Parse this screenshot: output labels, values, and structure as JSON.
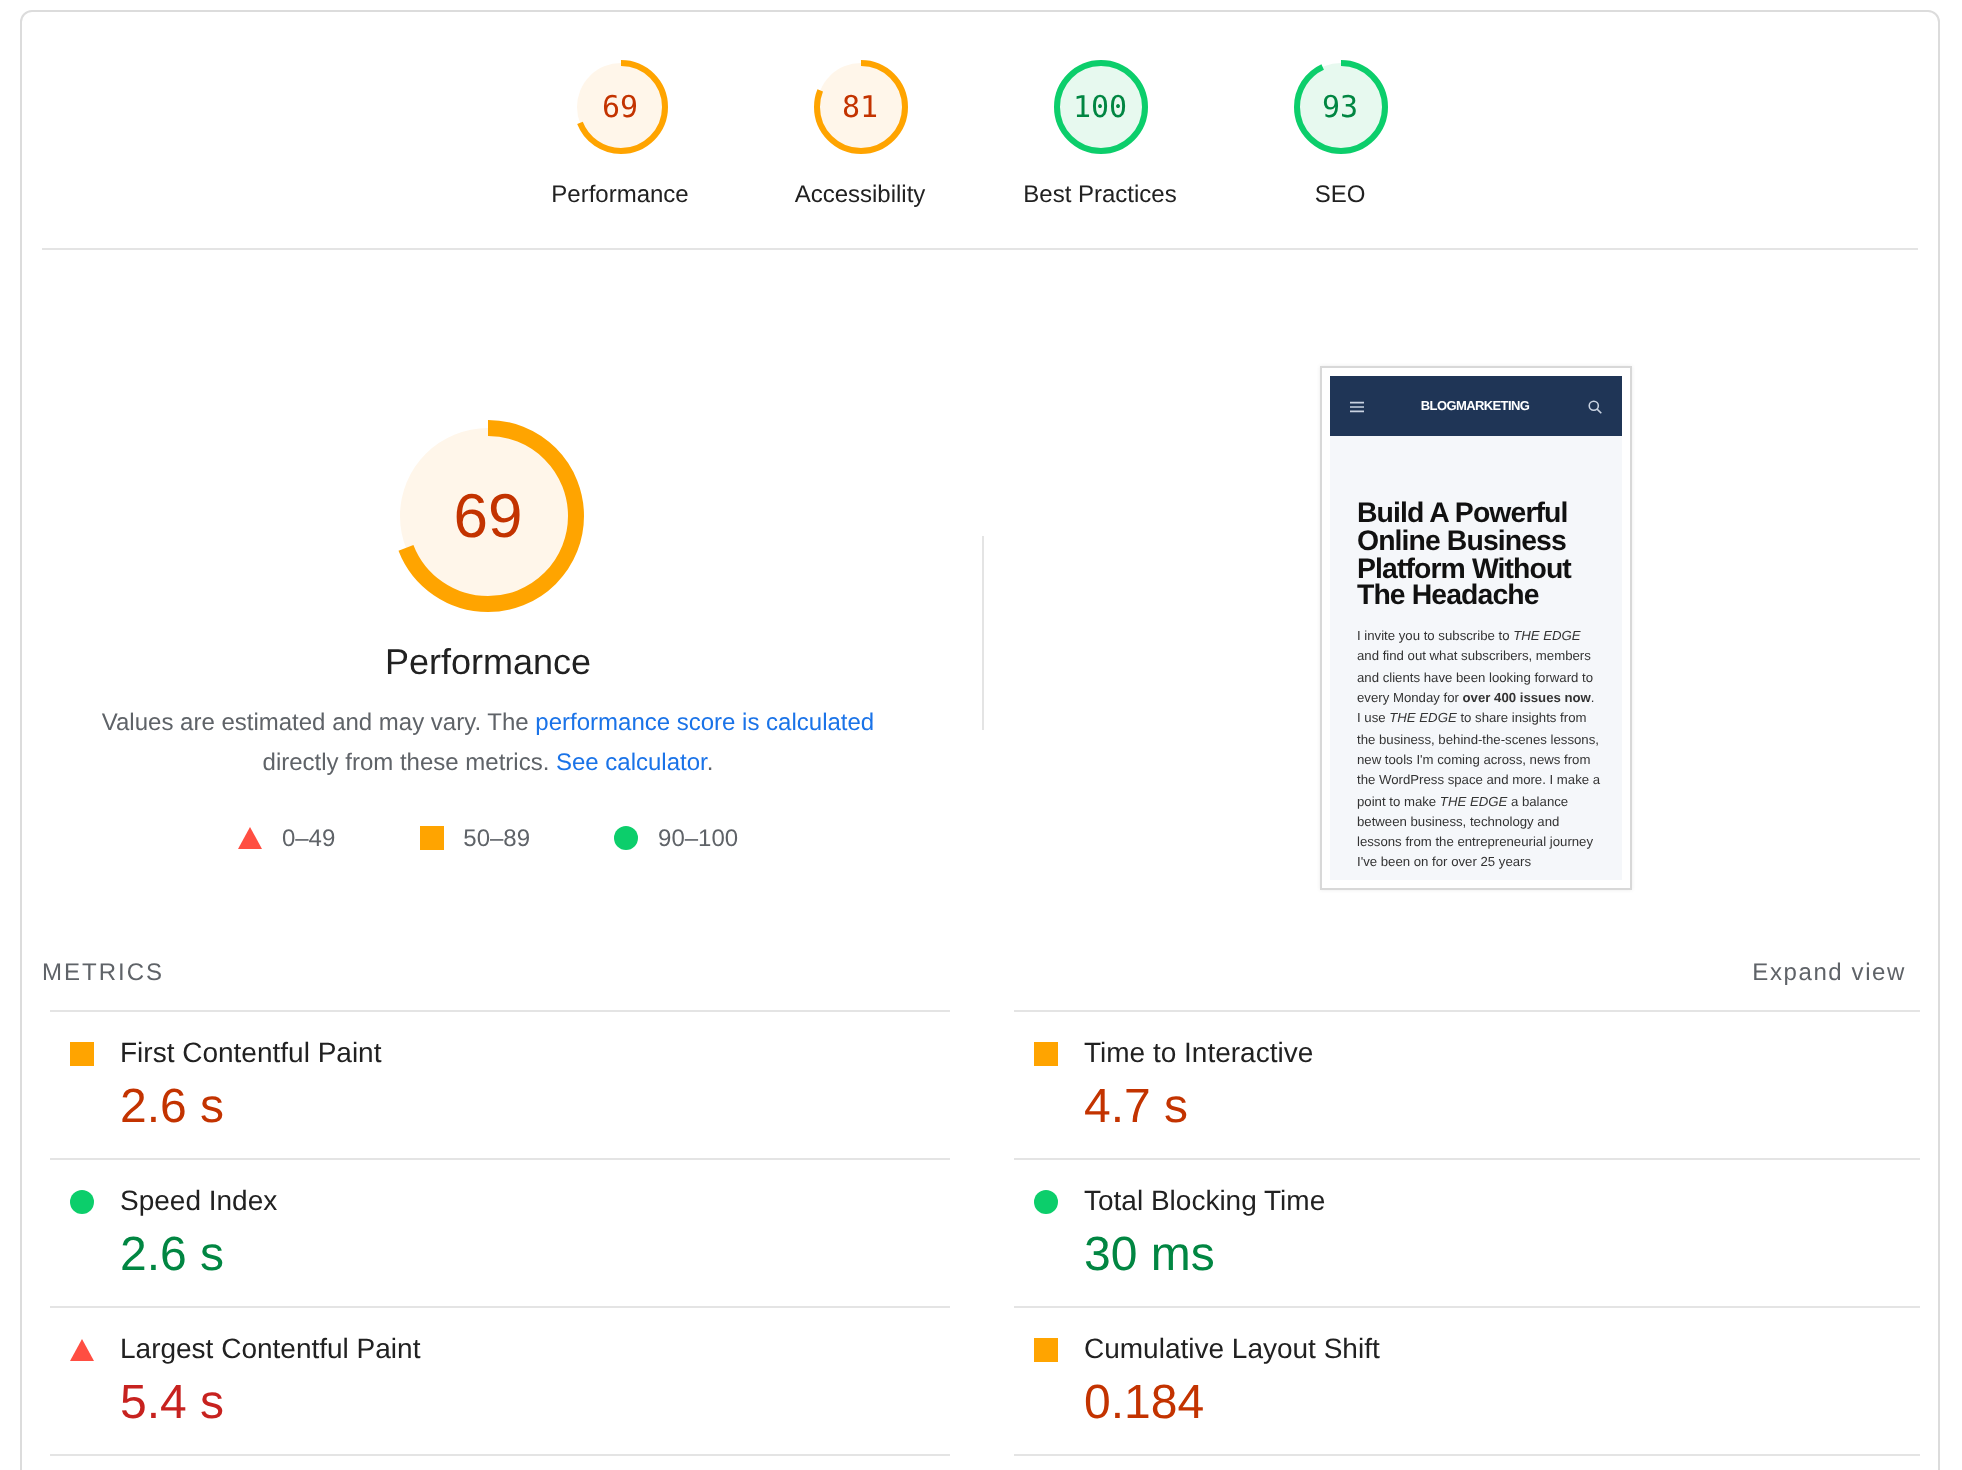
{
  "categories": [
    {
      "score": "69",
      "label": "Performance",
      "level": 0.69
    },
    {
      "score": "81",
      "label": "Accessibility",
      "level": 0.81
    },
    {
      "score": "100",
      "label": "Best Practices",
      "level": 1
    },
    {
      "score": "93",
      "label": "SEO",
      "level": 0.93
    }
  ],
  "performance": {
    "score": "69",
    "level": 0.69,
    "title": "Performance",
    "description": [
      {
        "kind": "text",
        "text": "Values are estimated and may vary. The "
      },
      {
        "kind": "link",
        "text": "performance score is calculated"
      },
      {
        "kind": "text",
        "text": " directly from these metrics. "
      },
      {
        "kind": "link",
        "text": "See calculator"
      },
      {
        "kind": "text",
        "text": "."
      }
    ],
    "legend": [
      {
        "kind": "fail",
        "color": "#ff4e42",
        "label": "0–49"
      },
      {
        "kind": "average",
        "color": "#ffa400",
        "label": "50–89"
      },
      {
        "kind": "pass",
        "color": "#0cce6b",
        "label": "90–100"
      }
    ]
  },
  "screenshot": {
    "logo": "BLOGMARKETING",
    "headline": "Build A Powerful Online Business Platform Without The Headache",
    "body": "I invite you to subscribe to *THE EDGE* and find out what subscribers, members and clients have been looking forward to every Monday for **over 400 issues now**. I use *THE EDGE* to share insights from the business, behind-the-scenes lessons, new tools I'm coming across, news from the WordPress space and more. I make a point to make *THE EDGE* a balance between business, technology and lessons from the entrepreneurial journey I've been on for over 25 years"
  },
  "metrics": {
    "title": "METRICS",
    "expand_label": "Expand view",
    "items": [
      {
        "label": "First Contentful Paint",
        "value": "2.6 s",
        "kind": "average",
        "color": "#ffa400"
      },
      {
        "label": "Speed Index",
        "value": "2.6 s",
        "kind": "pass",
        "color": "#0cce6b"
      },
      {
        "label": "Largest Contentful Paint",
        "value": "5.4 s",
        "kind": "fail",
        "color": "#ff4e42"
      },
      {
        "label": "Time to Interactive",
        "value": "4.7 s",
        "kind": "average",
        "color": "#ffa400"
      },
      {
        "label": "Total Blocking Time",
        "value": "30 ms",
        "kind": "pass",
        "color": "#0cce6b"
      },
      {
        "label": "Cumulative Layout Shift",
        "value": "0.184",
        "kind": "average",
        "color": "#ffa400"
      }
    ]
  }
}
